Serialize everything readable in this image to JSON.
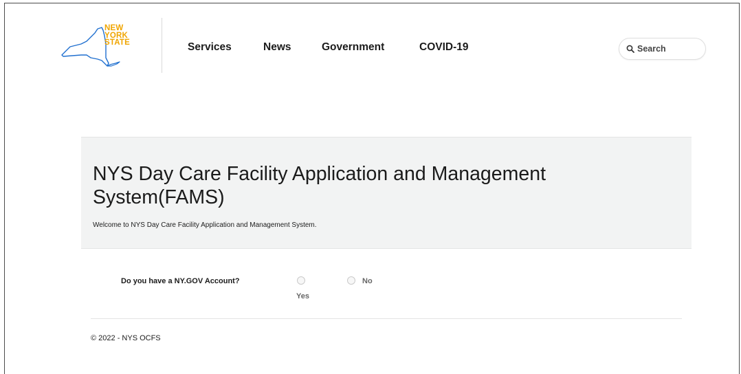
{
  "header": {
    "logo": {
      "line1": "NEW",
      "line2": "YORK",
      "line3": "STATE",
      "text_color": "#f0a500",
      "outline_color": "#1f6fcf"
    },
    "nav": [
      {
        "label": "Services"
      },
      {
        "label": "News"
      },
      {
        "label": "Government"
      },
      {
        "label": "COVID-19"
      }
    ],
    "search": {
      "placeholder": "Search",
      "icon": "search-icon"
    }
  },
  "banner": {
    "title": "NYS Day Care Facility Application and Management System(FAMS)",
    "subtitle": "Welcome to NYS Day Care Facility Application and Management System."
  },
  "form": {
    "question": "Do you have a NY.GOV Account?",
    "options": [
      {
        "label": "Yes",
        "selected": false
      },
      {
        "label": "No",
        "selected": false
      }
    ]
  },
  "footer": {
    "copyright": "© 2022 - NYS OCFS"
  }
}
